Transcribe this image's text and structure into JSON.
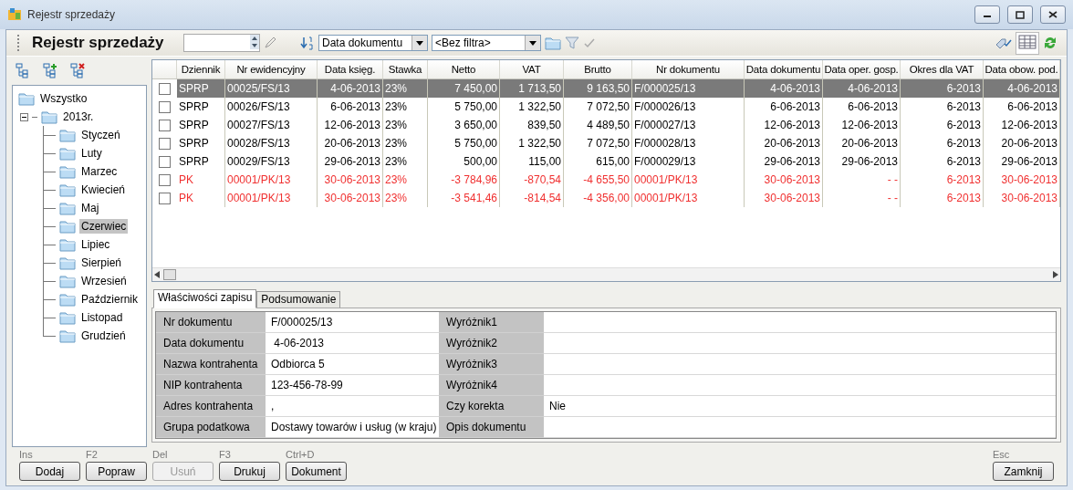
{
  "window": {
    "title": "Rejestr sprzedaży"
  },
  "toolbar": {
    "title": "Rejestr sprzedaży",
    "sort_field": "Data dokumentu",
    "filter": "<Bez filtra>",
    "grid_view_on": true
  },
  "tree": {
    "label": "Wszystko",
    "selected": false,
    "children": [
      {
        "label": "2013r.",
        "selected": false,
        "expanded": true,
        "children": [
          {
            "label": "Styczeń",
            "selected": false
          },
          {
            "label": "Luty",
            "selected": false
          },
          {
            "label": "Marzec",
            "selected": false
          },
          {
            "label": "Kwiecień",
            "selected": false
          },
          {
            "label": "Maj",
            "selected": false
          },
          {
            "label": "Czerwiec",
            "selected": true
          },
          {
            "label": "Lipiec",
            "selected": false
          },
          {
            "label": "Sierpień",
            "selected": false
          },
          {
            "label": "Wrzesień",
            "selected": false
          },
          {
            "label": "Październik",
            "selected": false
          },
          {
            "label": "Listopad",
            "selected": false
          },
          {
            "label": "Grudzień",
            "selected": false
          }
        ]
      }
    ]
  },
  "table": {
    "columns": [
      "Dziennik",
      "Nr ewidencyjny",
      "Data księg.",
      "Stawka",
      "Netto",
      "VAT",
      "Brutto",
      "Nr dokumentu",
      "Data dokumentu",
      "Data oper. gosp.",
      "Okres dla VAT",
      "Data obow. pod."
    ],
    "rows": [
      {
        "kind": "invoice",
        "selected": true,
        "checked": false,
        "cells": [
          "SPRP",
          "00025/FS/13",
          "4-06-2013",
          "23%",
          "7 450,00",
          "1 713,50",
          "9 163,50",
          "F/000025/13",
          "4-06-2013",
          "4-06-2013",
          "6-2013",
          "4-06-2013"
        ]
      },
      {
        "kind": "invoice",
        "selected": false,
        "checked": false,
        "cells": [
          "SPRP",
          "00026/FS/13",
          "6-06-2013",
          "23%",
          "5 750,00",
          "1 322,50",
          "7 072,50",
          "F/000026/13",
          "6-06-2013",
          "6-06-2013",
          "6-2013",
          "6-06-2013"
        ]
      },
      {
        "kind": "invoice",
        "selected": false,
        "checked": false,
        "cells": [
          "SPRP",
          "00027/FS/13",
          "12-06-2013",
          "23%",
          "3 650,00",
          "839,50",
          "4 489,50",
          "F/000027/13",
          "12-06-2013",
          "12-06-2013",
          "6-2013",
          "12-06-2013"
        ]
      },
      {
        "kind": "invoice",
        "selected": false,
        "checked": false,
        "cells": [
          "SPRP",
          "00028/FS/13",
          "20-06-2013",
          "23%",
          "5 750,00",
          "1 322,50",
          "7 072,50",
          "F/000028/13",
          "20-06-2013",
          "20-06-2013",
          "6-2013",
          "20-06-2013"
        ]
      },
      {
        "kind": "invoice",
        "selected": false,
        "checked": false,
        "cells": [
          "SPRP",
          "00029/FS/13",
          "29-06-2013",
          "23%",
          "500,00",
          "115,00",
          "615,00",
          "F/000029/13",
          "29-06-2013",
          "29-06-2013",
          "6-2013",
          "29-06-2013"
        ]
      },
      {
        "kind": "correction",
        "selected": false,
        "checked": false,
        "cells": [
          "PK",
          "00001/PK/13",
          "30-06-2013",
          "23%",
          "-3 784,96",
          "-870,54",
          "-4 655,50",
          "00001/PK/13",
          "30-06-2013",
          "- -",
          "6-2013",
          "30-06-2013"
        ]
      },
      {
        "kind": "correction",
        "selected": false,
        "checked": false,
        "cells": [
          "PK",
          "00001/PK/13",
          "30-06-2013",
          "23%",
          "-3 541,46",
          "-814,54",
          "-4 356,00",
          "00001/PK/13",
          "30-06-2013",
          "- -",
          "6-2013",
          "30-06-2013"
        ]
      }
    ]
  },
  "tabs": [
    {
      "label": "Właściwości zapisu",
      "selected": true
    },
    {
      "label": "Podsumowanie",
      "selected": false
    }
  ],
  "properties": [
    {
      "label": "Nr dokumentu",
      "value": "F/000025/13",
      "label_2": "Wyróżnik1"
    },
    {
      "label": "Data dokumentu",
      "value": " 4-06-2013",
      "label_2": "Wyróżnik2"
    },
    {
      "label": "Nazwa kontrahenta",
      "value": "Odbiorca 5",
      "label_2": "Wyróżnik3"
    },
    {
      "label": "NIP kontrahenta",
      "value": "123-456-78-99",
      "label_2": "Wyróżnik4"
    },
    {
      "label": "Adres kontrahenta",
      "value": ",",
      "label_2": "Czy korekta",
      "value_2": "Nie"
    },
    {
      "label": "Grupa podatkowa",
      "value": "Dostawy towarów i usług (w kraju)",
      "label_2": "Opis dokumentu"
    }
  ],
  "buttons": [
    {
      "shortcut": "Ins",
      "label": "Dodaj",
      "disabled": false
    },
    {
      "shortcut": "F2",
      "label": "Popraw",
      "disabled": false
    },
    {
      "shortcut": "Del",
      "label": "Usuń",
      "disabled": true
    },
    {
      "shortcut": "F3",
      "label": "Drukuj",
      "disabled": false
    },
    {
      "shortcut": "Ctrl+D",
      "label": "Dokument",
      "disabled": false
    }
  ],
  "close_button": {
    "shortcut": "Esc",
    "label": "Zamknij",
    "disabled": false
  }
}
